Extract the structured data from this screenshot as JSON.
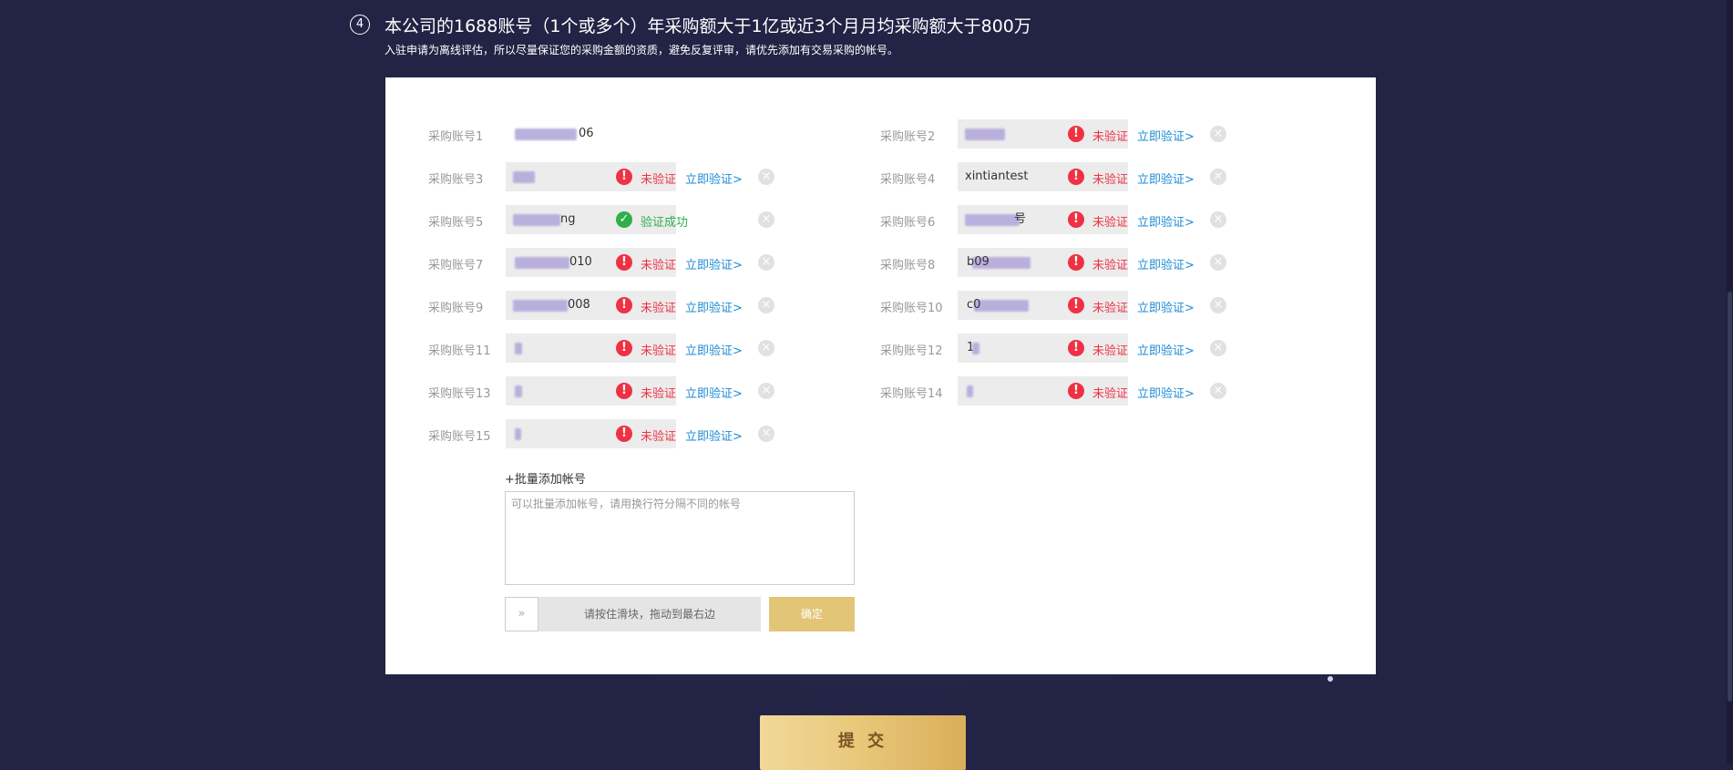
{
  "header": {
    "step_number": "4",
    "title": "本公司的1688账号（1个或多个）年采购额大于1亿或近3个月月均采购额大于800万",
    "subtitle": "入驻申请为离线评估，所以尽量保证您的采购金额的资质，避免反复评审，请优先添加有交易采购的帐号。"
  },
  "accounts": [
    {
      "label": "采购账号1",
      "value": "06",
      "status": "",
      "verify_link": ""
    },
    {
      "label": "采购账号2",
      "value": "",
      "status": "未验证",
      "verify_link": "立即验证>"
    },
    {
      "label": "采购账号3",
      "value": "",
      "status": "未验证",
      "verify_link": "立即验证>"
    },
    {
      "label": "采购账号4",
      "value": "xintiantest",
      "status": "未验证",
      "verify_link": "立即验证>"
    },
    {
      "label": "采购账号5",
      "value": "ng",
      "status": "验证成功",
      "verify_link": ""
    },
    {
      "label": "采购账号6",
      "value": "号",
      "status": "未验证",
      "verify_link": "立即验证>"
    },
    {
      "label": "采购账号7",
      "value": "010",
      "status": "未验证",
      "verify_link": "立即验证>"
    },
    {
      "label": "采购账号8",
      "value": "b09",
      "status": "未验证",
      "verify_link": "立即验证>"
    },
    {
      "label": "采购账号9",
      "value": "008",
      "status": "未验证",
      "verify_link": "立即验证>"
    },
    {
      "label": "采购账号10",
      "value": "c0",
      "status": "未验证",
      "verify_link": "立即验证>"
    },
    {
      "label": "采购账号11",
      "value": "",
      "status": "未验证",
      "verify_link": "立即验证>"
    },
    {
      "label": "采购账号12",
      "value": "1",
      "status": "未验证",
      "verify_link": "立即验证>"
    },
    {
      "label": "采购账号13",
      "value": "",
      "status": "未验证",
      "verify_link": "立即验证>"
    },
    {
      "label": "采购账号14",
      "value": "",
      "status": "未验证",
      "verify_link": "立即验证>"
    },
    {
      "label": "采购账号15",
      "value": "",
      "status": "未验证",
      "verify_link": "立即验证>"
    }
  ],
  "icons": {
    "error": "!",
    "success": "✓",
    "remove": "×",
    "slider_arrow": "»"
  },
  "batch": {
    "label": "+批量添加帐号",
    "placeholder": "可以批量添加帐号，请用换行符分隔不同的帐号"
  },
  "slider": {
    "text": "请按住滑块，拖动到最右边"
  },
  "buttons": {
    "confirm": "确定",
    "submit": "提 交"
  },
  "colors": {
    "background": "#232345",
    "error": "#ee3244",
    "success": "#2eaf4a",
    "link": "#1d8bd6",
    "confirm": "#e3c578",
    "submit": "#e9c97c"
  }
}
